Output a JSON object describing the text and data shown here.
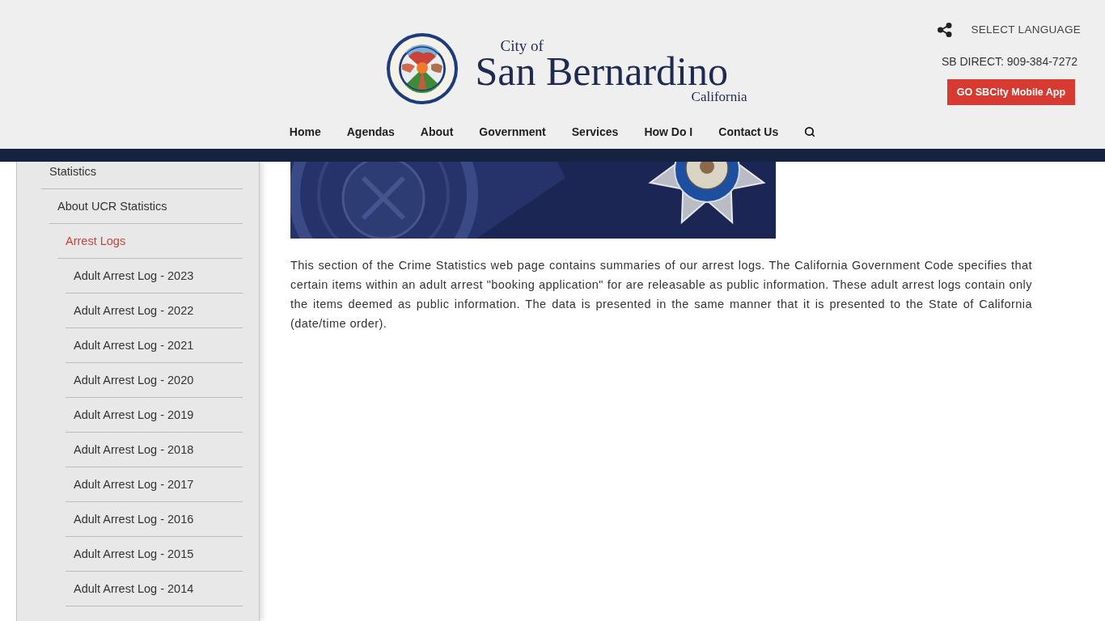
{
  "header": {
    "logo": {
      "line_1": "City of",
      "line_2": "San Bernardino",
      "line_3": "California"
    },
    "language_link": "SELECT LANGUAGE",
    "phone": "SB DIRECT: 909-384-7272",
    "app_button": "GO SBCity Mobile App",
    "nav": [
      "Home",
      "Agendas",
      "About",
      "Government",
      "Services",
      "How Do I",
      "Contact Us"
    ]
  },
  "sidebar": {
    "items": [
      {
        "label": "Statistics",
        "selected": false,
        "children": [
          {
            "label": "About UCR Statistics",
            "selected": false,
            "children": [
              {
                "label": "Arrest Logs",
                "selected": true,
                "children": [
                  {
                    "label": "Adult Arrest Log - 2023",
                    "selected": false
                  },
                  {
                    "label": "Adult Arrest Log - 2022",
                    "selected": false
                  },
                  {
                    "label": "Adult Arrest Log - 2021",
                    "selected": false
                  },
                  {
                    "label": "Adult Arrest Log - 2020",
                    "selected": false
                  },
                  {
                    "label": "Adult Arrest Log - 2019",
                    "selected": false
                  },
                  {
                    "label": "Adult Arrest Log - 2018",
                    "selected": false
                  },
                  {
                    "label": "Adult Arrest Log - 2017",
                    "selected": false
                  },
                  {
                    "label": "Adult Arrest Log - 2016",
                    "selected": false
                  },
                  {
                    "label": "Adult Arrest Log - 2015",
                    "selected": false
                  },
                  {
                    "label": "Adult Arrest Log - 2014",
                    "selected": false
                  }
                ]
              }
            ]
          }
        ]
      }
    ]
  },
  "content": {
    "intro": "This section of the Crime Statistics web page contains summaries of our arrest logs. The California Government Code specifies that certain items within an adult arrest \"booking application\" for are releasable as public information. These adult arrest logs contain only the items deemed as public information. The data is presented in the same manner that it is presented to the State of California (date/time order)."
  }
}
